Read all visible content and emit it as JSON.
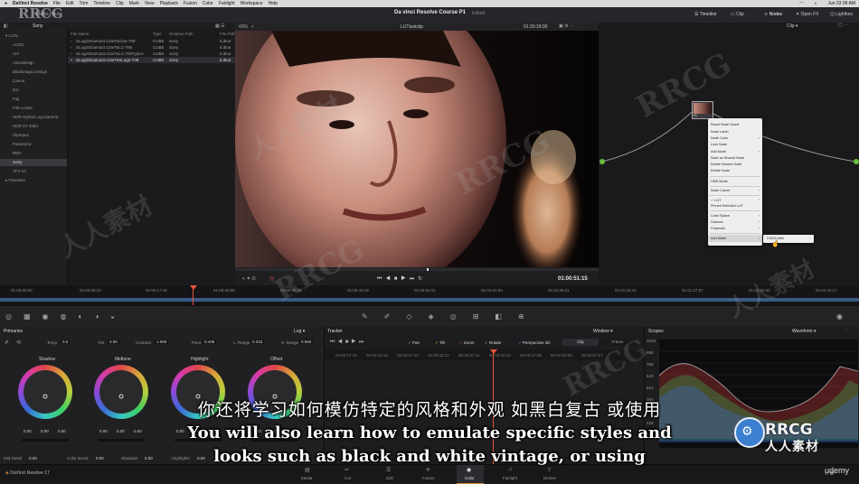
{
  "menubar": {
    "app": "DaVinci Resolve",
    "items": [
      "File",
      "Edit",
      "Trim",
      "Timeline",
      "Clip",
      "Mark",
      "View",
      "Playback",
      "Fusion",
      "Color",
      "Fairlight",
      "Workspace",
      "Help"
    ],
    "right_time": "Jun 23 06 AM"
  },
  "topbar": {
    "media_pool_label": "Media Pool",
    "project_title": "Da vinci Resolve Course P1",
    "project_status": "Edited",
    "timeline_btn": "Timeline",
    "clip_btn": "Clip",
    "nodes_btn": "Nodes",
    "openfx_btn": "Open FX",
    "lightbox_btn": "Lightbox"
  },
  "media_pool": {
    "header_sony": "Sony",
    "tree": [
      {
        "label": "LUTs",
        "selected": false
      },
      {
        "label": "ACES",
        "selected": false
      },
      {
        "label": "Arri",
        "selected": false
      },
      {
        "label": "Astrodesign",
        "selected": false
      },
      {
        "label": "Blackmagic Design",
        "selected": false
      },
      {
        "label": "Canon",
        "selected": false
      },
      {
        "label": "DJI",
        "selected": false
      },
      {
        "label": "Fuji",
        "selected": false
      },
      {
        "label": "Film Looks",
        "selected": false
      },
      {
        "label": "HDR Hybrid Log-Gamma",
        "selected": false
      },
      {
        "label": "HDR ST 2084",
        "selected": false
      },
      {
        "label": "Olympus",
        "selected": false
      },
      {
        "label": "Panasonic",
        "selected": false
      },
      {
        "label": "RED",
        "selected": false
      },
      {
        "label": "Sony",
        "selected": true
      },
      {
        "label": "VFX IO",
        "selected": false
      },
      {
        "label": "Favorites",
        "selected": false
      }
    ],
    "columns": [
      "File Name",
      "Type",
      "Relative Path",
      "File Path"
    ],
    "rows": [
      [
        "SLog2SGamut3.CineToCine-709",
        "CUBE",
        "Sony",
        "/Librar"
      ],
      [
        "SLog2SGamut3.CineToLC-709",
        "CUBE",
        "Sony",
        "/Librar"
      ],
      [
        "SLog2SGamut3.CineToLC-709TypeA",
        "CUBE",
        "Sony",
        "/Librar"
      ],
      [
        "SLog3SGamut3.CineToSLog2-709",
        "CUBE",
        "Sony",
        "/Librar"
      ]
    ]
  },
  "viewer": {
    "zoom": "43%",
    "clip_name": "LUTtestclip",
    "timecode_top": "01:20:19:00",
    "timecode": "01:00:51:15"
  },
  "nodes": {
    "mode": "Clip",
    "node_label": "01"
  },
  "context_menu": {
    "items": [
      {
        "label": "Reset Node Grade",
        "arrow": false
      },
      {
        "label": "Node Label",
        "arrow": false
      },
      {
        "label": "Node Color",
        "arrow": true
      },
      {
        "label": "Lock Node",
        "arrow": false
      },
      {
        "label": "Add Node",
        "arrow": true
      },
      {
        "label": "Save as Shared Node",
        "arrow": false
      },
      {
        "label": "Delete Shared Node",
        "arrow": false
      },
      {
        "label": "Delete Node",
        "arrow": false
      },
      {
        "label": "HDR Mode",
        "arrow": false
      },
      {
        "label": "Node Cache",
        "arrow": true
      },
      {
        "label": "LUT",
        "arrow": true
      },
      {
        "label": "Pinned Selected LUT",
        "arrow": false
      },
      {
        "label": "Color Space",
        "arrow": true
      },
      {
        "label": "Gamma",
        "arrow": true
      },
      {
        "label": "Channels",
        "arrow": true
      },
      {
        "label": "Add Matte",
        "arrow": true
      }
    ],
    "submenu_item": "CDD2.M##"
  },
  "timeline": {
    "ticks": [
      "01:00:00:00",
      "01:00:08:22",
      "01:00:17:15",
      "01:00:26:08",
      "01:00:35:01",
      "01:00:43:18",
      "01:00:52:11",
      "01:01:01:04",
      "01:01:09:21",
      "01:01:18:14",
      "01:01:27:07",
      "01:01:36:00",
      "01:01:44:17",
      "01:01:53:10"
    ]
  },
  "primaries": {
    "title": "Primaries",
    "mode": "Log",
    "temp_label": "Temp",
    "temp": "0.0",
    "tint_label": "Tint",
    "tint": "0.00",
    "contrast_label": "Contrast",
    "contrast": "1.000",
    "pivot_label": "Pivot",
    "pivot": "0.435",
    "lrange_label": "L. Range",
    "lrange": "0.333",
    "hrange_label": "H. Range",
    "hrange": "0.550",
    "wheels": [
      {
        "label": "Shadow",
        "values": [
          "0.00",
          "0.00",
          "0.00"
        ]
      },
      {
        "label": "Midtone",
        "values": [
          "0.00",
          "0.00",
          "0.00"
        ]
      },
      {
        "label": "Highlight",
        "values": [
          "0.00",
          "0.00",
          "0.00"
        ]
      },
      {
        "label": "Offset",
        "values": [
          "0.00",
          "0.00",
          "0.00"
        ]
      }
    ],
    "bottom": [
      {
        "label": "Mid Detail",
        "value": "0.00"
      },
      {
        "label": "Color Boost",
        "value": "0.00"
      },
      {
        "label": "Shadows",
        "value": "0.00"
      },
      {
        "label": "Highlights",
        "value": "0.00"
      }
    ]
  },
  "tracker": {
    "title": "Tracker",
    "window_label": "Window",
    "checks": [
      "Pan",
      "Tilt",
      "Zoom",
      "Rotate",
      "Perspective 3D"
    ],
    "clip_tab": "Clip",
    "frame_tab": "Frame",
    "ticks": [
      "00:00:17:15",
      "00:00:22:14",
      "00:00:27:13",
      "00:00:32:12",
      "00:00:37:11",
      "00:00:42:10",
      "00:00:47:09",
      "00:00:52:08",
      "00:00:57:07"
    ]
  },
  "scopes": {
    "title": "Scopes",
    "type": "Waveform",
    "scale": [
      "1023",
      "896",
      "768",
      "640",
      "512",
      "384",
      "256",
      "128",
      "0"
    ]
  },
  "pagebar": {
    "app_label": "DaVinci Resolve 17",
    "pages": [
      "Media",
      "Cut",
      "Edit",
      "Fusion",
      "Color",
      "Fairlight",
      "Deliver"
    ],
    "active": "Color"
  },
  "subtitles": {
    "cn": "你还将学习如何模仿特定的风格和外观 如黑白复古 或使用",
    "en1": "You will also learn how to emulate specific styles and",
    "en2": "looks such as black and white vintage, or using"
  },
  "watermarks": {
    "logo": "RRCG",
    "logo_cn": "人人素材",
    "corner": "RRCG",
    "udemy": "udemy"
  },
  "colors": {
    "accent": "#e8533a",
    "active_tab": "#d68a3a",
    "panel": "#202023"
  }
}
